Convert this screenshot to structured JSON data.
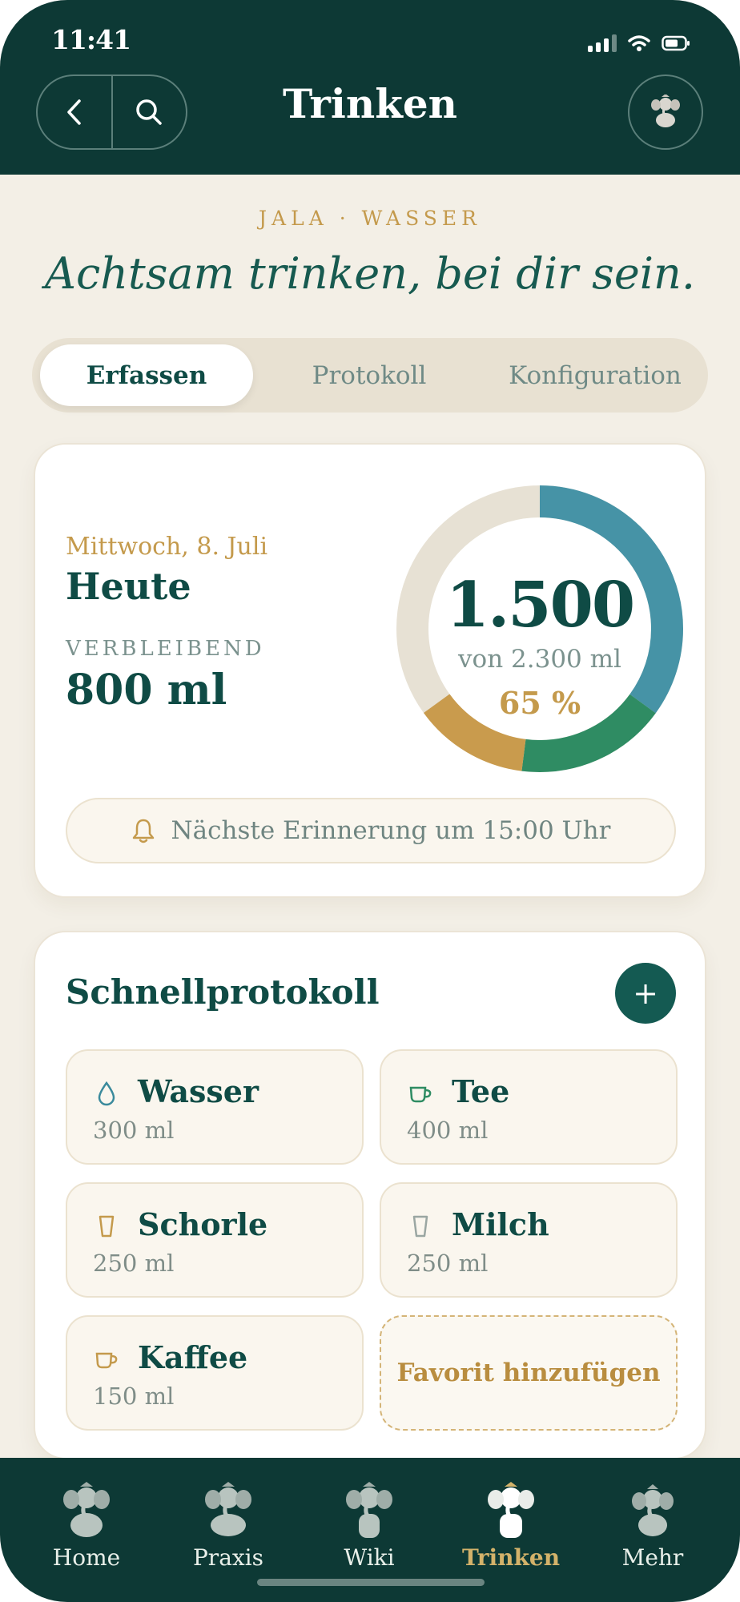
{
  "status_bar": {
    "time": "11:41"
  },
  "header": {
    "title": "Trinken"
  },
  "intro": {
    "eyebrow": "JALA · WASSER",
    "motto": "Achtsam trinken, bei dir sein."
  },
  "tabs": [
    {
      "label": "Erfassen",
      "active": true
    },
    {
      "label": "Protokoll",
      "active": false
    },
    {
      "label": "Konfiguration",
      "active": false
    }
  ],
  "today": {
    "date": "Mittwoch, 8. Juli",
    "title": "Heute",
    "remaining_label": "VERBLEIBEND",
    "remaining_value": "800 ml",
    "consumed": "1.500",
    "goal_text": "von 2.300 ml",
    "percent_text": "65 %",
    "progress_segments": [
      {
        "color": "#4693a6",
        "fraction": 0.35
      },
      {
        "color": "#2f8c63",
        "fraction": 0.17
      },
      {
        "color": "#c99b4d",
        "fraction": 0.13
      }
    ],
    "ring_track_color": "#e7e1d4",
    "reminder": "Nächste Erinnerung um 15:00 Uhr"
  },
  "quick": {
    "title": "Schnellprotokoll",
    "add_label": "+",
    "drinks": [
      {
        "name": "Wasser",
        "amount": "300 ml",
        "icon": "drop-icon"
      },
      {
        "name": "Tee",
        "amount": "400 ml",
        "icon": "tea-cup-icon"
      },
      {
        "name": "Schorle",
        "amount": "250 ml",
        "icon": "glass-icon"
      },
      {
        "name": "Milch",
        "amount": "250 ml",
        "icon": "glass-icon"
      },
      {
        "name": "Kaffee",
        "amount": "150 ml",
        "icon": "coffee-cup-icon"
      }
    ],
    "favorite_label": "Favorit hinzufügen"
  },
  "bottom_nav": [
    {
      "label": "Home",
      "active": false
    },
    {
      "label": "Praxis",
      "active": false
    },
    {
      "label": "Wiki",
      "active": false
    },
    {
      "label": "Trinken",
      "active": true
    },
    {
      "label": "Mehr",
      "active": false
    }
  ],
  "colors": {
    "primary": "#0d3935",
    "accent": "#c49a4c",
    "background": "#f3efe6"
  }
}
